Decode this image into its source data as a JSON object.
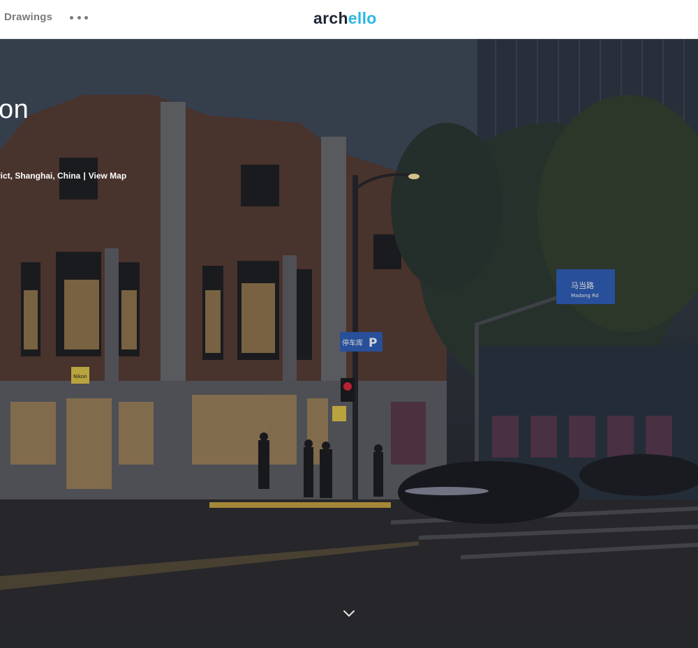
{
  "header": {
    "nav_drawings": "Drawings",
    "more_icon": "more-horizontal-icon",
    "logo": {
      "part1": "arc",
      "part2": "h",
      "part3": "ello"
    },
    "accent_color": "#29b8e3"
  },
  "hero": {
    "title": "on",
    "location": "rict, Shanghai, China",
    "separator": "|",
    "map_link": "View Map",
    "scroll_icon": "chevron-down-icon",
    "signs": {
      "street": "马当路",
      "street_en": "Madang Rd",
      "parking": "停车库",
      "parking_letter": "P",
      "store_brand": "Nikon"
    }
  }
}
